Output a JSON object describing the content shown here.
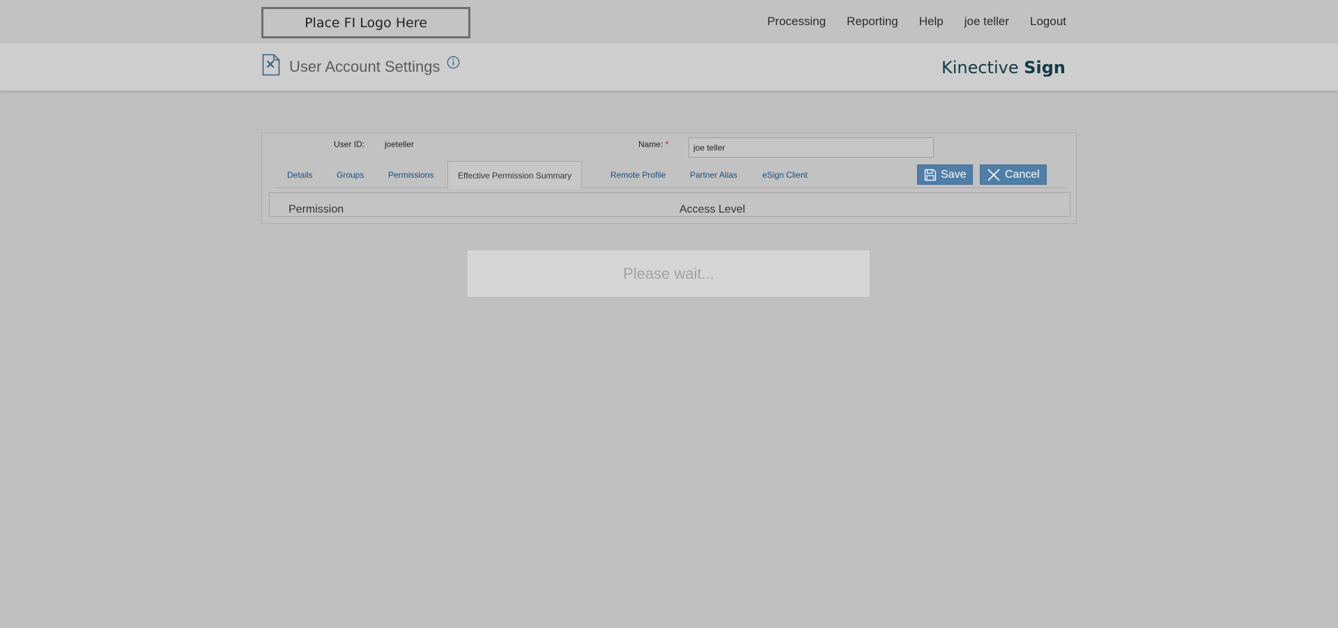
{
  "header": {
    "logo_text": "Place FI Logo Here",
    "nav": [
      "Processing",
      "Reporting",
      "Help",
      "joe teller",
      "Logout"
    ]
  },
  "title_band": {
    "page_title": "User Account Settings",
    "brand_light": "Kinective",
    "brand_bold": "Sign",
    "icons": [
      "document-icon",
      "info-icon"
    ]
  },
  "form": {
    "user_id_label": "User ID:",
    "user_id_value": "joeteller",
    "name_label": "Name:",
    "name_required_mark": "*",
    "name_value": "joe teller"
  },
  "tabs": [
    "Details",
    "Groups",
    "Permissions",
    "Effective Permission Summary",
    "Remote Profile",
    "Partner Alias",
    "eSign Client"
  ],
  "active_tab": "Effective Permission Summary",
  "buttons": {
    "save": "Save",
    "cancel": "Cancel"
  },
  "table": {
    "columns": [
      "Permission",
      "Access Level"
    ]
  },
  "loading_text": "Please wait...",
  "colors": {
    "page_bg": "#bfbfbf",
    "button_bg": "#4f7ea8",
    "tab_link": "#1a4d80",
    "brand": "#123c46",
    "required": "#b02020"
  }
}
